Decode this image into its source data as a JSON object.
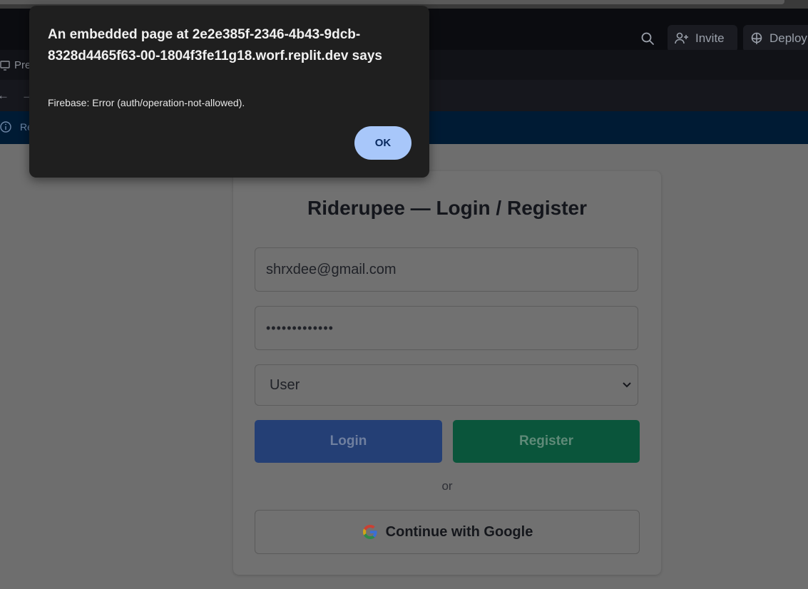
{
  "toolbar": {
    "invite_label": "Invite",
    "deploy_label": "Deploy",
    "preview_tab_label": "Pre",
    "banner_text": "Rea",
    "back_arrow": "←",
    "forward_arrow": "→"
  },
  "dialog": {
    "title": "An embedded page at 2e2e385f-2346-4b43-9dcb-8328d4465f63-00-1804f3fe11g18.worf.replit.dev says",
    "message": "Firebase: Error (auth/operation-not-allowed).",
    "ok_label": "OK",
    "accent_color": "#a8c7fa"
  },
  "auth_card": {
    "title": "Riderupee — Login / Register",
    "email_value": "shrxdee@gmail.com",
    "password_mask": "•••••••••••••",
    "role_value": "User",
    "login_label": "Login",
    "register_label": "Register",
    "or_text": "or",
    "google_label": "Continue with Google",
    "login_color": "#2563eb",
    "register_color": "#059669"
  }
}
